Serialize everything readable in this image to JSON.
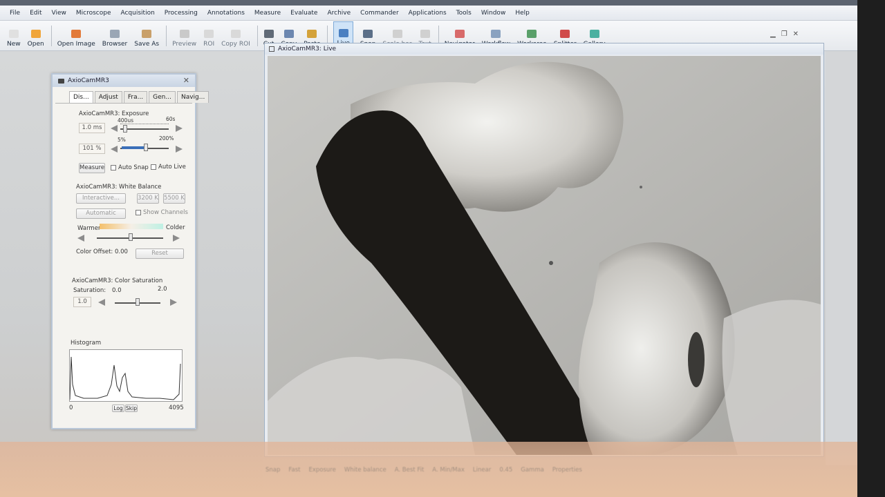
{
  "menu": [
    "File",
    "Edit",
    "View",
    "Microscope",
    "Acquisition",
    "Processing",
    "Annotations",
    "Measure",
    "Evaluate",
    "Archive",
    "Commander",
    "Applications",
    "Tools",
    "Window",
    "Help"
  ],
  "toolbar": {
    "items": [
      {
        "label": "New",
        "color": "#e0e0e0"
      },
      {
        "label": "Open",
        "color": "#f0a53a"
      },
      {
        "label": "Open Image",
        "color": "#e27a3a"
      },
      {
        "label": "Browser",
        "color": "#9aa6b5"
      },
      {
        "label": "Save As",
        "color": "#c9a06a"
      },
      {
        "label": "Preview",
        "color": "#c9c9c9"
      },
      {
        "label": "ROI",
        "color": "#d9d9d9"
      },
      {
        "label": "Copy ROI",
        "color": "#d9d9d9"
      },
      {
        "label": "Cut",
        "color": "#606a77"
      },
      {
        "label": "Copy",
        "color": "#6c87b0"
      },
      {
        "label": "Paste",
        "color": "#d4a23a"
      },
      {
        "label": "Live",
        "color": "#4a7fc1"
      },
      {
        "label": "Snap",
        "color": "#5b6f88"
      },
      {
        "label": "Scale bar",
        "color": "#d0d0d0"
      },
      {
        "label": "Text",
        "color": "#d0d0d0"
      },
      {
        "label": "Navigator",
        "color": "#d86a6a"
      },
      {
        "label": "Workflow",
        "color": "#8aa2c0"
      },
      {
        "label": "Workarea",
        "color": "#5aa06a"
      },
      {
        "label": "Splitter",
        "color": "#d04a4a"
      },
      {
        "label": "Gallery",
        "color": "#4ab0a0"
      }
    ]
  },
  "dialog": {
    "title": "AxioCamMR3",
    "tabs": [
      "Dis...",
      "Adjust",
      "Fra...",
      "Gen...",
      "Navig..."
    ],
    "exposure": {
      "heading": "AxioCamMR3: Exposure",
      "time_value": "1.0 ms",
      "time_min": "400us",
      "time_max": "60s",
      "percent_value": "101 %",
      "percent_min": "5%",
      "percent_max": "200%",
      "measure_label": "Measure",
      "auto_snap_label": "Auto Snap",
      "auto_live_label": "Auto Live"
    },
    "white_balance": {
      "heading": "AxioCamMR3: White Balance",
      "interactive_label": "Interactive...",
      "k3200_label": "3200 K",
      "k5500_label": "5500 K",
      "automatic_label": "Automatic",
      "show_channels_label": "Show Channels",
      "warmer_label": "Warmer",
      "colder_label": "Colder",
      "color_offset": "Color Offset: 0.00",
      "reset_label": "Reset"
    },
    "saturation": {
      "heading": "AxioCamMR3: Color Saturation",
      "label": "Saturation:",
      "min": "0.0",
      "max": "2.0",
      "value": "1.0"
    },
    "histogram": {
      "heading": "Histogram",
      "min": "0",
      "max": "4095",
      "log_label": "Log",
      "skip_label": "Skip"
    }
  },
  "live_window": {
    "title": "AxioCamMR3: Live"
  },
  "bottom_bar": [
    "Snap",
    "Fast",
    "Exposure",
    "White balance",
    "A. Best Fit",
    "A. Min/Max",
    "Linear",
    "0.45",
    "Gamma",
    "Properties"
  ]
}
